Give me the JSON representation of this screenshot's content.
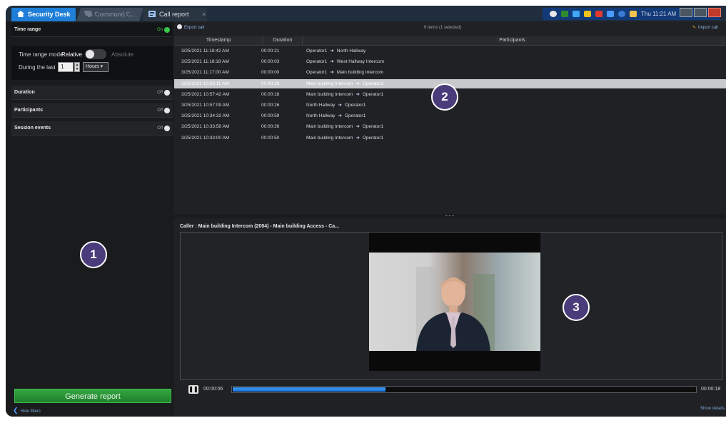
{
  "titlebar": {
    "tabs": [
      {
        "label": "Security Desk",
        "icon": "home-icon"
      },
      {
        "label": "Command C...",
        "icon": "monitor-icon"
      },
      {
        "label": "Call report",
        "icon": "report-icon"
      }
    ],
    "close_glyph": "×",
    "clock": "Thu 11:21 AM"
  },
  "filters": {
    "time_range": {
      "title": "Time range",
      "toggle": "On",
      "mode_label": "Time range mode",
      "mode_relative": "Relative",
      "mode_absolute": "Absolute",
      "during_label": "During the last",
      "during_value": "1",
      "unit": "Hours"
    },
    "duration": {
      "title": "Duration",
      "toggle": "Off"
    },
    "participants": {
      "title": "Participants",
      "toggle": "Off"
    },
    "session_events": {
      "title": "Session events",
      "toggle": "Off"
    },
    "generate_button": "Generate report",
    "hide_filters": "Hide filters"
  },
  "report": {
    "export_label": "Export call",
    "items_summary": "9 items (1 selected)",
    "import_label": "Import call",
    "columns": [
      "Timestamp",
      "Duration",
      "Participants"
    ],
    "rows": [
      {
        "timestamp": "3/25/2021 11:18:42 AM",
        "duration": "00:00:21",
        "from": "Operator1",
        "to": "North Hallway",
        "selected": false
      },
      {
        "timestamp": "3/25/2021 11:18:18 AM",
        "duration": "00:00:03",
        "from": "Operator1",
        "to": "West Hallway Intercom",
        "selected": false
      },
      {
        "timestamp": "3/25/2021 11:17:00 AM",
        "duration": "00:00:00",
        "from": "Operator1",
        "to": "Main building Intercom",
        "selected": false
      },
      {
        "timestamp": "3/25/2021 10:58:11 AM",
        "duration": "00:00:18",
        "from": "Main building Intercom",
        "to": "Operator1",
        "selected": true
      },
      {
        "timestamp": "3/25/2021 10:57:42 AM",
        "duration": "00:00:18",
        "from": "Main building Intercom",
        "to": "Operator1",
        "selected": false
      },
      {
        "timestamp": "3/25/2021 10:57:09 AM",
        "duration": "00:00:26",
        "from": "North Hallway",
        "to": "Operator1",
        "selected": false
      },
      {
        "timestamp": "3/25/2021 10:34:32 AM",
        "duration": "00:00:59",
        "from": "North Hallway",
        "to": "Operator1",
        "selected": false
      },
      {
        "timestamp": "3/25/2021 10:33:58 AM",
        "duration": "00:00:26",
        "from": "Main building Intercom",
        "to": "Operator1",
        "selected": false
      },
      {
        "timestamp": "3/25/2021 10:33:00 AM",
        "duration": "00:00:50",
        "from": "Main building Intercom",
        "to": "Operator1",
        "selected": false
      }
    ],
    "arrow_glyph": "➜"
  },
  "player": {
    "caller": "Caller : Main building Intercom (2004) - Main building Access - Ca...",
    "current_time": "00:00:06",
    "end_time": "00:00:18",
    "progress_fraction": 0.33,
    "pause_glyph": "❚❚",
    "show_details": "Show details"
  },
  "callouts": [
    "1",
    "2",
    "3"
  ],
  "colors": {
    "accent": "#1f7fd8",
    "generate_green": "#2a9a36",
    "callout_purple": "#4a3b7a",
    "selected_row": "#c7c9cc"
  }
}
